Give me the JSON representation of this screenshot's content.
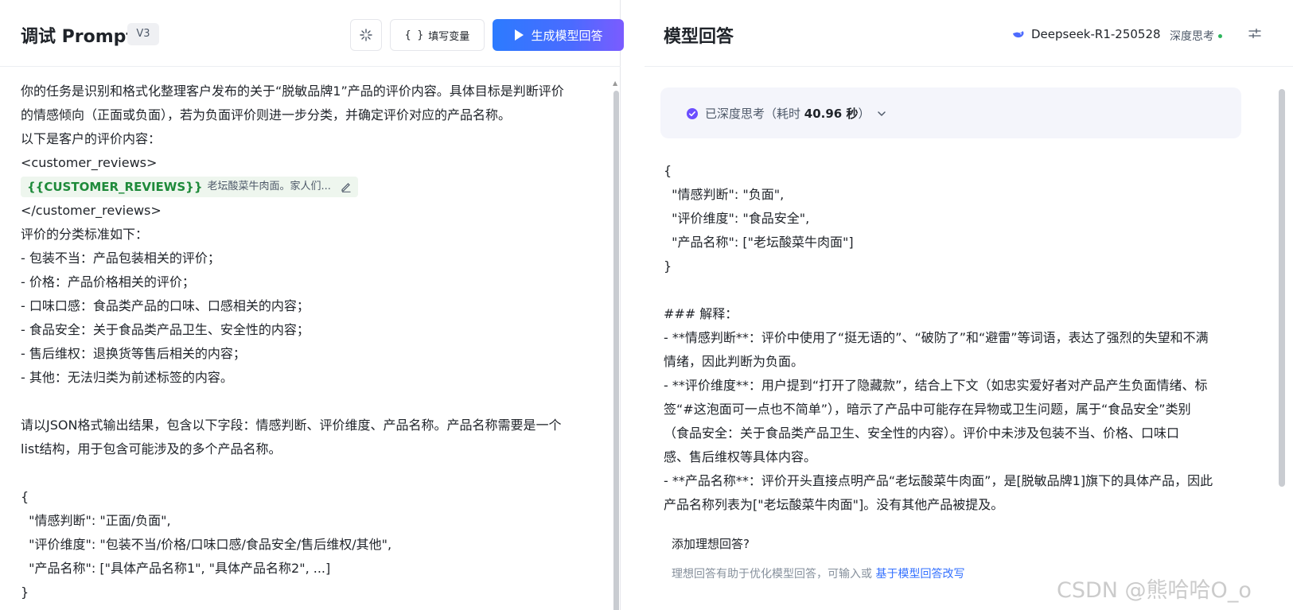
{
  "left": {
    "title": "调试 Prompt",
    "version": "V3",
    "fill_vars_label": "填写变量",
    "fill_vars_braces": "{ }",
    "generate_label": "生成模型回答",
    "lines_before_chip": [
      "你的任务是识别和格式化整理客户发布的关于“脱敏品牌1”产品的评价内容。具体目标是判断评价",
      "的情感倾向（正面或负面），若为负面评价则进一步分类，并确定评价对应的产品名称。",
      "以下是客户的评价内容：",
      "<customer_reviews>"
    ],
    "chip": {
      "name": "{{CUSTOMER_REVIEWS}}",
      "value": "老坛酸菜牛肉面。家人们..."
    },
    "lines_after_chip": [
      "</customer_reviews>",
      "评价的分类标准如下：",
      "- 包装不当：产品包装相关的评价；",
      "- 价格：产品价格相关的评价；",
      "- 口味口感：食品类产品的口味、口感相关的内容；",
      "- 食品安全：关于食品类产品卫生、安全性的内容；",
      "- 售后维权：退换货等售后相关的内容；",
      "- 其他：无法归类为前述标签的内容。",
      "",
      "请以JSON格式输出结果，包含以下字段：情感判断、评价维度、产品名称。产品名称需要是一个",
      "list结构，用于包含可能涉及的多个产品名称。",
      "",
      "{",
      "  \"情感判断\": \"正面/负面\",",
      "  \"评价维度\": \"包装不当/价格/口味口感/食品安全/售后维权/其他\",",
      "  \"产品名称\": [\"具体产品名称1\", \"具体产品名称2\", ...]",
      "}"
    ]
  },
  "right": {
    "title": "模型回答",
    "model_name": "Deepseek-R1-250528",
    "deep_think_label": "深度思考",
    "think_status": "已深度思考（耗时",
    "think_time": "40.96 秒",
    "think_close": "）",
    "answer_lines": [
      "{",
      "  \"情感判断\": \"负面\",",
      "  \"评价维度\": \"食品安全\",",
      "  \"产品名称\": [\"老坛酸菜牛肉面\"]",
      "}",
      "",
      "### 解释：",
      "- **情感判断**：评价中使用了“挺无语的”、“破防了”和“避雷”等词语，表达了强烈的失望和不满",
      "情绪，因此判断为负面。",
      "- **评价维度**：用户提到“打开了隐藏款”，结合上下文（如忠实爱好者对产品产生负面情绪、标",
      "签“#这泡面可一点也不简单”），暗示了产品中可能存在异物或卫生问题，属于“食品安全”类别",
      "（食品安全：关于食品类产品卫生、安全性的内容）。评价中未涉及包装不当、价格、口味口",
      "感、售后维权等具体内容。",
      "- **产品名称**：评价开头直接点明产品“老坛酸菜牛肉面”，是[脱敏品牌1]旗下的具体产品，因此",
      "产品名称列表为[\"老坛酸菜牛肉面\"]。没有其他产品被提及。"
    ],
    "ideal_title": "添加理想回答?",
    "ideal_desc": "理想回答有助于优化模型回答，可输入或 ",
    "ideal_link": "基于模型回答改写"
  },
  "watermark": "CSDN @熊哈哈O_o",
  "colors": {
    "accent": "#3370ff",
    "chip_text": "#1e8a3a",
    "chip_bg": "#eef6ee",
    "think_check": "#6b4eff",
    "status_dot": "#2db55d"
  },
  "icons": {
    "magic": "sparkle-icon",
    "play": "play-icon",
    "edit": "pencil-icon",
    "model": "deepseek-logo-icon",
    "settings": "sliders-icon",
    "check": "check-circle-icon",
    "chevron": "chevron-down-icon"
  }
}
